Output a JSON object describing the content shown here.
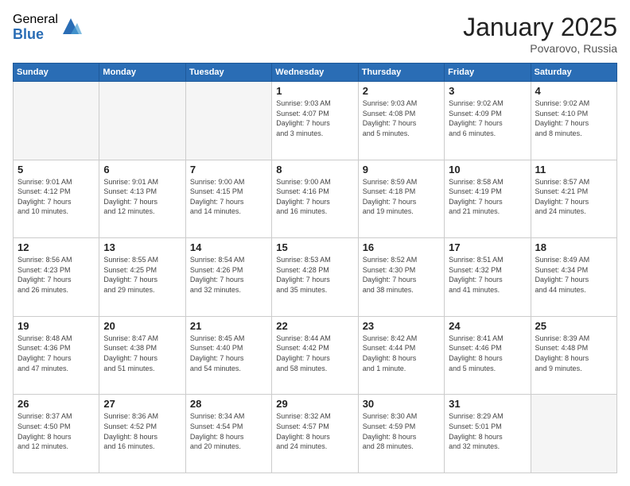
{
  "logo": {
    "general": "General",
    "blue": "Blue"
  },
  "header": {
    "month": "January 2025",
    "location": "Povarovo, Russia"
  },
  "weekdays": [
    "Sunday",
    "Monday",
    "Tuesday",
    "Wednesday",
    "Thursday",
    "Friday",
    "Saturday"
  ],
  "weeks": [
    [
      {
        "day": "",
        "info": ""
      },
      {
        "day": "",
        "info": ""
      },
      {
        "day": "",
        "info": ""
      },
      {
        "day": "1",
        "info": "Sunrise: 9:03 AM\nSunset: 4:07 PM\nDaylight: 7 hours\nand 3 minutes."
      },
      {
        "day": "2",
        "info": "Sunrise: 9:03 AM\nSunset: 4:08 PM\nDaylight: 7 hours\nand 5 minutes."
      },
      {
        "day": "3",
        "info": "Sunrise: 9:02 AM\nSunset: 4:09 PM\nDaylight: 7 hours\nand 6 minutes."
      },
      {
        "day": "4",
        "info": "Sunrise: 9:02 AM\nSunset: 4:10 PM\nDaylight: 7 hours\nand 8 minutes."
      }
    ],
    [
      {
        "day": "5",
        "info": "Sunrise: 9:01 AM\nSunset: 4:12 PM\nDaylight: 7 hours\nand 10 minutes."
      },
      {
        "day": "6",
        "info": "Sunrise: 9:01 AM\nSunset: 4:13 PM\nDaylight: 7 hours\nand 12 minutes."
      },
      {
        "day": "7",
        "info": "Sunrise: 9:00 AM\nSunset: 4:15 PM\nDaylight: 7 hours\nand 14 minutes."
      },
      {
        "day": "8",
        "info": "Sunrise: 9:00 AM\nSunset: 4:16 PM\nDaylight: 7 hours\nand 16 minutes."
      },
      {
        "day": "9",
        "info": "Sunrise: 8:59 AM\nSunset: 4:18 PM\nDaylight: 7 hours\nand 19 minutes."
      },
      {
        "day": "10",
        "info": "Sunrise: 8:58 AM\nSunset: 4:19 PM\nDaylight: 7 hours\nand 21 minutes."
      },
      {
        "day": "11",
        "info": "Sunrise: 8:57 AM\nSunset: 4:21 PM\nDaylight: 7 hours\nand 24 minutes."
      }
    ],
    [
      {
        "day": "12",
        "info": "Sunrise: 8:56 AM\nSunset: 4:23 PM\nDaylight: 7 hours\nand 26 minutes."
      },
      {
        "day": "13",
        "info": "Sunrise: 8:55 AM\nSunset: 4:25 PM\nDaylight: 7 hours\nand 29 minutes."
      },
      {
        "day": "14",
        "info": "Sunrise: 8:54 AM\nSunset: 4:26 PM\nDaylight: 7 hours\nand 32 minutes."
      },
      {
        "day": "15",
        "info": "Sunrise: 8:53 AM\nSunset: 4:28 PM\nDaylight: 7 hours\nand 35 minutes."
      },
      {
        "day": "16",
        "info": "Sunrise: 8:52 AM\nSunset: 4:30 PM\nDaylight: 7 hours\nand 38 minutes."
      },
      {
        "day": "17",
        "info": "Sunrise: 8:51 AM\nSunset: 4:32 PM\nDaylight: 7 hours\nand 41 minutes."
      },
      {
        "day": "18",
        "info": "Sunrise: 8:49 AM\nSunset: 4:34 PM\nDaylight: 7 hours\nand 44 minutes."
      }
    ],
    [
      {
        "day": "19",
        "info": "Sunrise: 8:48 AM\nSunset: 4:36 PM\nDaylight: 7 hours\nand 47 minutes."
      },
      {
        "day": "20",
        "info": "Sunrise: 8:47 AM\nSunset: 4:38 PM\nDaylight: 7 hours\nand 51 minutes."
      },
      {
        "day": "21",
        "info": "Sunrise: 8:45 AM\nSunset: 4:40 PM\nDaylight: 7 hours\nand 54 minutes."
      },
      {
        "day": "22",
        "info": "Sunrise: 8:44 AM\nSunset: 4:42 PM\nDaylight: 7 hours\nand 58 minutes."
      },
      {
        "day": "23",
        "info": "Sunrise: 8:42 AM\nSunset: 4:44 PM\nDaylight: 8 hours\nand 1 minute."
      },
      {
        "day": "24",
        "info": "Sunrise: 8:41 AM\nSunset: 4:46 PM\nDaylight: 8 hours\nand 5 minutes."
      },
      {
        "day": "25",
        "info": "Sunrise: 8:39 AM\nSunset: 4:48 PM\nDaylight: 8 hours\nand 9 minutes."
      }
    ],
    [
      {
        "day": "26",
        "info": "Sunrise: 8:37 AM\nSunset: 4:50 PM\nDaylight: 8 hours\nand 12 minutes."
      },
      {
        "day": "27",
        "info": "Sunrise: 8:36 AM\nSunset: 4:52 PM\nDaylight: 8 hours\nand 16 minutes."
      },
      {
        "day": "28",
        "info": "Sunrise: 8:34 AM\nSunset: 4:54 PM\nDaylight: 8 hours\nand 20 minutes."
      },
      {
        "day": "29",
        "info": "Sunrise: 8:32 AM\nSunset: 4:57 PM\nDaylight: 8 hours\nand 24 minutes."
      },
      {
        "day": "30",
        "info": "Sunrise: 8:30 AM\nSunset: 4:59 PM\nDaylight: 8 hours\nand 28 minutes."
      },
      {
        "day": "31",
        "info": "Sunrise: 8:29 AM\nSunset: 5:01 PM\nDaylight: 8 hours\nand 32 minutes."
      },
      {
        "day": "",
        "info": ""
      }
    ]
  ]
}
